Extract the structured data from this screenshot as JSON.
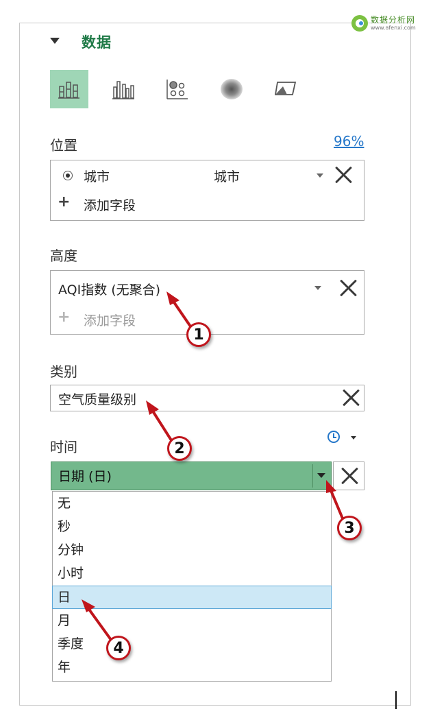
{
  "watermark": {
    "name": "数据分析网",
    "url": "www.afenxi.com"
  },
  "section": {
    "title": "数据"
  },
  "viz_types": [
    {
      "name": "stacked-column-icon",
      "selected": true
    },
    {
      "name": "clustered-column-icon",
      "selected": false
    },
    {
      "name": "bubble-icon",
      "selected": false
    },
    {
      "name": "heat-map-icon",
      "selected": false
    },
    {
      "name": "region-icon",
      "selected": false
    }
  ],
  "location": {
    "label": "位置",
    "confidence": "96%",
    "field_name": "城市",
    "field_type": "城市",
    "add_field": "添加字段"
  },
  "height": {
    "label": "高度",
    "field_name": "AQI指数 (无聚合)",
    "add_field": "添加字段"
  },
  "category": {
    "label": "类别",
    "field_name": "空气质量级别"
  },
  "time": {
    "label": "时间",
    "selected_value": "日期 (日)",
    "options": [
      "无",
      "秒",
      "分钟",
      "小时",
      "日",
      "月",
      "季度",
      "年"
    ],
    "highlighted_option": "日"
  },
  "callouts": [
    "1",
    "2",
    "3",
    "4"
  ],
  "colors": {
    "accent_green": "#1f7a47",
    "selected_green": "#73b88c",
    "link_blue": "#2577c9",
    "callout_red": "#c0151c"
  }
}
